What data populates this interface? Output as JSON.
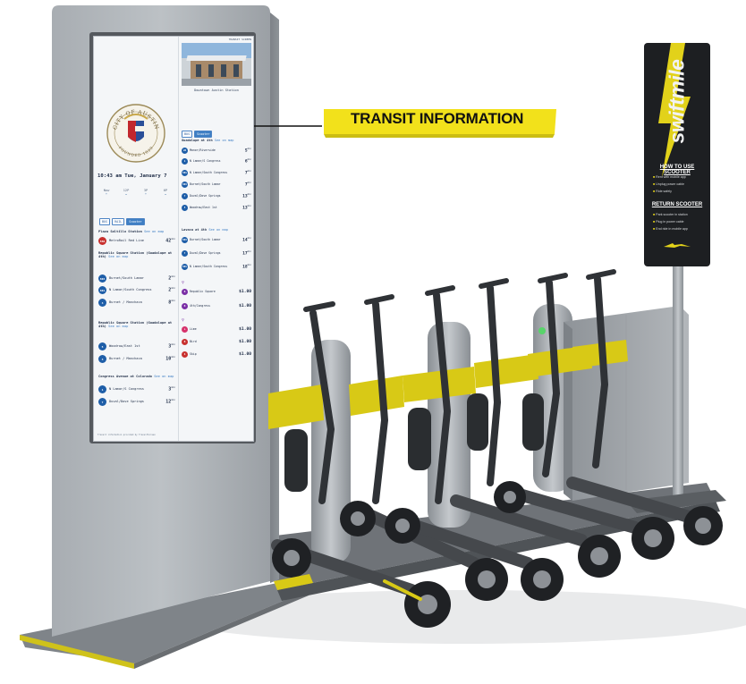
{
  "callout": {
    "label": "TRANSIT INFORMATION"
  },
  "kiosk_screen": {
    "seal": {
      "top_text": "CITY OF AUSTIN",
      "bottom_text": "FOUNDED 1839"
    },
    "clock": "10:43 am  Tue, January 7",
    "weather": {
      "labels": [
        "Now",
        "12P",
        "3P",
        "6P"
      ],
      "icons": [
        "sun-icon",
        "cloud-icon",
        "sun-icon",
        "cloud-icon"
      ]
    },
    "left_filters": [
      "BUS",
      "RAIL",
      "Scooter"
    ],
    "left_stops": [
      {
        "title": "Plaza Saltillo Station",
        "map_link": "See on map",
        "departures": [
          {
            "route": "550",
            "name": "MetroRail Red Line",
            "minutes": "42",
            "unit": "min",
            "color": "red"
          }
        ]
      },
      {
        "title": "Republic Square Station (Guadalupe at 4th)",
        "map_link": "See on map",
        "departures": [
          {
            "route": "803",
            "name": "Burnet/South Lamar",
            "minutes": "2",
            "unit": "min",
            "color": "blue"
          },
          {
            "route": "801",
            "name": "N Lamar/South Congress",
            "minutes": "2",
            "unit": "min",
            "color": "blue"
          },
          {
            "route": "3",
            "name": "Burnet / Manchaca",
            "minutes": "8",
            "unit": "min",
            "color": "blue"
          }
        ]
      },
      {
        "title": "Republic Square Station (Guadalupe at 4th)",
        "map_link": "See on map",
        "departures": [
          {
            "route": "5",
            "name": "Woodrow/East 1st",
            "minutes": "3",
            "unit": "min",
            "color": "blue"
          },
          {
            "route": "3",
            "name": "Burnet / Manchaca",
            "minutes": "10",
            "unit": "min",
            "color": "blue"
          }
        ]
      },
      {
        "title": "Congress Avenue at Colorado",
        "map_link": "See on map",
        "departures": [
          {
            "route": "1",
            "name": "N Lamar/S Congress",
            "minutes": "3",
            "unit": "min",
            "color": "blue"
          },
          {
            "route": "7",
            "name": "Duval/Dove Springs",
            "minutes": "12",
            "unit": "min",
            "color": "blue"
          }
        ]
      }
    ],
    "right_header": "TRANSIT SCREEN",
    "photo_caption": "Downtown Austin Station",
    "right_filters": [
      "BUS",
      "Scooter"
    ],
    "right_sections": [
      {
        "title": "Guadalupe at 4th",
        "map_link": "See on map",
        "departures": [
          {
            "route": "20",
            "name": "Manor/Riverside",
            "minutes": "5",
            "unit": "min",
            "color": "blue"
          },
          {
            "route": "1",
            "name": "N Lamar/S Congress",
            "minutes": "6",
            "unit": "min",
            "color": "blue"
          },
          {
            "route": "801",
            "name": "N Lamar/South Congress",
            "minutes": "7",
            "unit": "min",
            "color": "blue"
          },
          {
            "route": "803",
            "name": "Burnet/South Lamar",
            "minutes": "7",
            "unit": "min",
            "color": "blue"
          },
          {
            "route": "7",
            "name": "Duval/Dove Springs",
            "minutes": "13",
            "unit": "min",
            "color": "blue"
          },
          {
            "route": "5",
            "name": "Woodrow/East 1st",
            "minutes": "13",
            "unit": "min",
            "color": "blue"
          }
        ]
      },
      {
        "title": "Lavaca at 4th",
        "map_link": "See on map",
        "departures": [
          {
            "route": "803",
            "name": "Burnet/South Lamar",
            "minutes": "14",
            "unit": "min",
            "color": "blue"
          },
          {
            "route": "7",
            "name": "Duval/Dove Springs",
            "minutes": "17",
            "unit": "min",
            "color": "blue"
          },
          {
            "route": "801",
            "name": "N Lamar/South Congress",
            "minutes": "18",
            "unit": "min",
            "color": "blue"
          }
        ]
      }
    ],
    "bikeshare": [
      {
        "route": "B",
        "name": "Republic Square",
        "price": "$1.00",
        "color": "purple"
      },
      {
        "route": "B",
        "name": "4th/Congress",
        "price": "$1.00",
        "color": "purple"
      }
    ],
    "scooters": [
      {
        "route": "L",
        "name": "Lime",
        "price": "$1.00",
        "color": "pink"
      },
      {
        "route": "B",
        "name": "Bird",
        "price": "$1.00",
        "color": "red"
      },
      {
        "route": "S",
        "name": "Skip",
        "price": "$1.00",
        "color": "red"
      }
    ],
    "footer": "Transit information provided by TransitScreen"
  },
  "sign": {
    "brand": "swiftmile",
    "how_to_title": "HOW TO USE SCOOTER",
    "how_to_steps": [
      "Rent with mobile app",
      "Unplug power cable",
      "Ride safely"
    ],
    "return_title": "RETURN SCOOTER",
    "return_steps": [
      "Park scooter in station",
      "Plug in power cable",
      "End ride in mobile app"
    ]
  },
  "colors": {
    "accent_yellow": "#e2d21a",
    "kiosk_gray": "#9ea4a9",
    "scooter_dark": "#3a3d41",
    "transit_blue": "#1e5ea8"
  }
}
